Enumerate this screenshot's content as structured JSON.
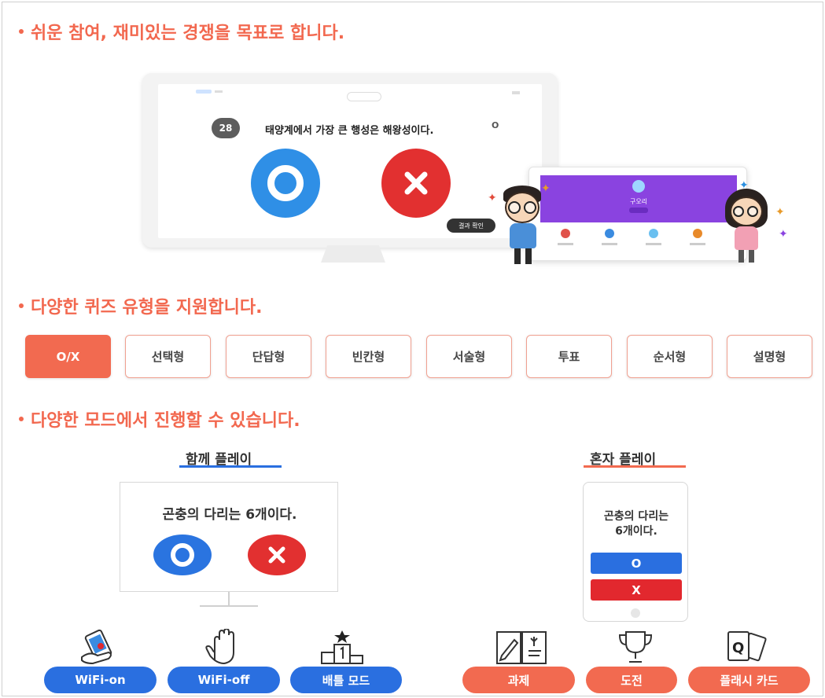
{
  "sections": {
    "participation": {
      "heading": "쉬운 참여, 재미있는 경쟁을 목표로 합니다."
    },
    "quiz_types": {
      "heading": "다양한 퀴즈 유형을 지원합니다."
    },
    "modes": {
      "heading": "다양한 모드에서 진행할 수 있습니다."
    }
  },
  "monitor": {
    "question_number": "28",
    "question_text": "태양계에서 가장 큰 행성은 해왕성이다.",
    "side_mark": "O",
    "result_button": "결과 확인"
  },
  "tablet": {
    "player_name": "구오리"
  },
  "quiz_types": [
    {
      "label": "O/X",
      "active": true
    },
    {
      "label": "선택형",
      "active": false
    },
    {
      "label": "단답형",
      "active": false
    },
    {
      "label": "빈칸형",
      "active": false
    },
    {
      "label": "서술형",
      "active": false
    },
    {
      "label": "투표",
      "active": false
    },
    {
      "label": "순서형",
      "active": false
    },
    {
      "label": "설명형",
      "active": false
    }
  ],
  "modes": {
    "together": {
      "title": "함께 플레이",
      "question": "곤충의 다리는 6개이다.",
      "underline_color": "#2a6fe0",
      "options": [
        {
          "label": "WiFi-on",
          "icon": "phone-hand-icon"
        },
        {
          "label": "WiFi-off",
          "icon": "raised-hand-icon"
        },
        {
          "label": "배틀 모드",
          "icon": "podium-icon"
        }
      ]
    },
    "solo": {
      "title": "혼자 플레이",
      "question_line1": "곤충의 다리는",
      "question_line2": "6개이다.",
      "o_label": "O",
      "x_label": "X",
      "underline_color": "#f26a50",
      "options": [
        {
          "label": "과제",
          "icon": "notebook-icon"
        },
        {
          "label": "도전",
          "icon": "trophy-icon"
        },
        {
          "label": "플래시 카드",
          "icon": "cards-icon"
        }
      ]
    }
  },
  "colors": {
    "accent": "#f2684f",
    "o_blue": "#2f8fe6",
    "x_red": "#e23030",
    "pill_blue": "#2a6fe0",
    "pill_red": "#f26a50"
  }
}
